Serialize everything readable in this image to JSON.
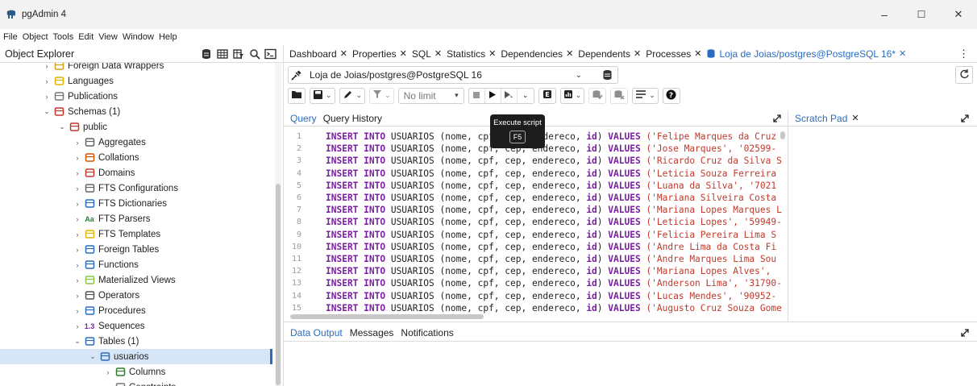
{
  "window": {
    "title": "pgAdmin 4",
    "minimize": "–",
    "maximize": "☐",
    "close": "✕"
  },
  "menu": [
    "File",
    "Object",
    "Tools",
    "Edit",
    "View",
    "Window",
    "Help"
  ],
  "object_explorer": {
    "title": "Object Explorer",
    "tree": [
      {
        "label": "Foreign Data Wrappers",
        "indent": 1,
        "chev": "›",
        "icon": "foreign-data-wrappers-icon",
        "color": "#d4a017"
      },
      {
        "label": "Languages",
        "indent": 1,
        "chev": "›",
        "icon": "languages-icon",
        "color": "#e2b400"
      },
      {
        "label": "Publications",
        "indent": 1,
        "chev": "›",
        "icon": "publications-icon",
        "color": "#777777"
      },
      {
        "label": "Schemas (1)",
        "indent": 1,
        "chev": "⌄",
        "icon": "schemas-icon",
        "color": "#c0392b"
      },
      {
        "label": "public",
        "indent": 2,
        "chev": "⌄",
        "icon": "public-schema-icon",
        "color": "#c0392b"
      },
      {
        "label": "Aggregates",
        "indent": 3,
        "chev": "›",
        "icon": "aggregates-icon",
        "color": "#666666"
      },
      {
        "label": "Collations",
        "indent": 3,
        "chev": "›",
        "icon": "collations-icon",
        "color": "#d35400"
      },
      {
        "label": "Domains",
        "indent": 3,
        "chev": "›",
        "icon": "domains-icon",
        "color": "#c0392b"
      },
      {
        "label": "FTS Configurations",
        "indent": 3,
        "chev": "›",
        "icon": "fts-configurations-icon",
        "color": "#666666"
      },
      {
        "label": "FTS Dictionaries",
        "indent": 3,
        "chev": "›",
        "icon": "fts-dictionaries-icon",
        "color": "#2a6cc2"
      },
      {
        "label": "FTS Parsers",
        "indent": 3,
        "chev": "›",
        "icon": "fts-parsers-icon",
        "color": "#2e7d32",
        "glyph": "Aa"
      },
      {
        "label": "FTS Templates",
        "indent": 3,
        "chev": "›",
        "icon": "fts-templates-icon",
        "color": "#e2b400"
      },
      {
        "label": "Foreign Tables",
        "indent": 3,
        "chev": "›",
        "icon": "foreign-tables-icon",
        "color": "#2a6cc2"
      },
      {
        "label": "Functions",
        "indent": 3,
        "chev": "›",
        "icon": "functions-icon",
        "color": "#2a6cc2"
      },
      {
        "label": "Materialized Views",
        "indent": 3,
        "chev": "›",
        "icon": "materialized-views-icon",
        "color": "#8bc34a"
      },
      {
        "label": "Operators",
        "indent": 3,
        "chev": "›",
        "icon": "operators-icon",
        "color": "#555555"
      },
      {
        "label": "Procedures",
        "indent": 3,
        "chev": "›",
        "icon": "procedures-icon",
        "color": "#2a6cc2"
      },
      {
        "label": "Sequences",
        "indent": 3,
        "chev": "›",
        "icon": "sequences-icon",
        "color": "#7a1fa2",
        "glyph": "1.3"
      },
      {
        "label": "Tables (1)",
        "indent": 3,
        "chev": "⌄",
        "icon": "tables-icon",
        "color": "#2a6cc2"
      },
      {
        "label": "usuarios",
        "indent": 4,
        "chev": "⌄",
        "icon": "table-icon",
        "color": "#2a6cc2",
        "selected": true
      },
      {
        "label": "Columns",
        "indent": 5,
        "chev": "›",
        "icon": "columns-icon",
        "color": "#2e7d32"
      },
      {
        "label": "Constraints",
        "indent": 5,
        "chev": "›",
        "icon": "constraints-icon",
        "color": "#777777"
      }
    ]
  },
  "tabs": [
    {
      "label": "Dashboard"
    },
    {
      "label": "Properties"
    },
    {
      "label": "SQL"
    },
    {
      "label": "Statistics"
    },
    {
      "label": "Dependencies"
    },
    {
      "label": "Dependents"
    },
    {
      "label": "Processes"
    },
    {
      "label": "Loja de Joias/postgres@PostgreSQL 16*",
      "active": true
    }
  ],
  "tab_close": "✕",
  "tabs_more": "⋮",
  "connection": {
    "label": "Loja de Joias/postgres@PostgreSQL 16"
  },
  "toolbar": {
    "limit_label": "No limit",
    "tooltip_title": "Execute script",
    "tooltip_key": "F5"
  },
  "query_tabs": [
    "Query",
    "Query History"
  ],
  "scratch_pad": {
    "title": "Scratch Pad"
  },
  "output_tabs": [
    "Data Output",
    "Messages",
    "Notifications"
  ],
  "colors": {
    "accent": "#2a6cc2",
    "keyword": "#7a1fa2",
    "string": "#c0392b"
  },
  "sql": {
    "prefix_kw": "INSERT INTO",
    "table": " USUARIOS (nome, cpf, cep, endereco, ",
    "id_kw": "id",
    "close": ") ",
    "values_kw": "VALUES",
    "lines": [
      {
        "n": "1",
        "val": " ('Felipe Marques da Cruz"
      },
      {
        "n": "2",
        "val": " ('Jose Marques', '02599-"
      },
      {
        "n": "3",
        "val": " ('Ricardo Cruz da Silva S"
      },
      {
        "n": "4",
        "val": " ('Leticia Souza Ferreira"
      },
      {
        "n": "5",
        "val": " ('Luana da Silva', '7021"
      },
      {
        "n": "6",
        "val": " ('Mariana Silveira Costa"
      },
      {
        "n": "7",
        "val": " ('Mariana Lopes Marques L"
      },
      {
        "n": "8",
        "val": " ('Leticia Lopes', '59949-"
      },
      {
        "n": "9",
        "val": " ('Felicia Pereira Lima S"
      },
      {
        "n": "10",
        "val": " ('Andre Lima da Costa Fi"
      },
      {
        "n": "11",
        "val": " ('Andre Marques Lima Sou"
      },
      {
        "n": "12",
        "val": " ('Mariana Lopes Alves',"
      },
      {
        "n": "13",
        "val": " ('Anderson Lima', '31790-"
      },
      {
        "n": "14",
        "val": " ('Lucas Mendes', '90952-"
      },
      {
        "n": "15",
        "val": " ('Augusto Cruz Souza Gome"
      }
    ]
  }
}
